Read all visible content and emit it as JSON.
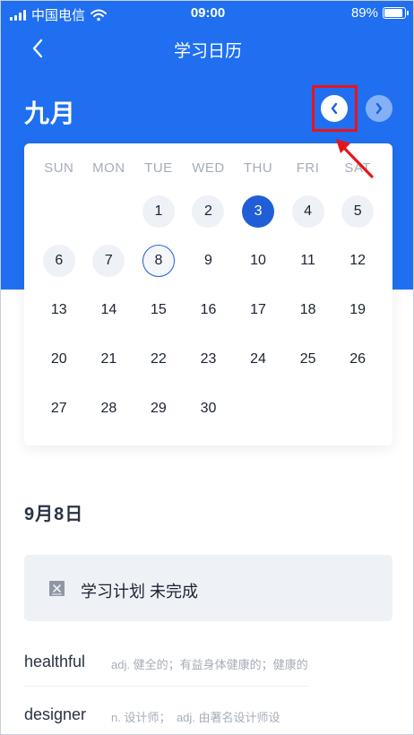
{
  "status_bar": {
    "carrier": "中国电信",
    "time": "09:00",
    "battery": "89%",
    "battery_level": 0.89
  },
  "nav": {
    "title": "学习日历",
    "back_icon": "chevron-left-icon"
  },
  "calendar": {
    "month": "九月",
    "prev_icon": "chevron-left-icon",
    "next_icon": "chevron-right-icon",
    "weekdays": [
      "SUN",
      "MON",
      "TUE",
      "WED",
      "THU",
      "FRI",
      "SAT"
    ],
    "weeks": [
      [
        {
          "d": ""
        },
        {
          "d": ""
        },
        {
          "d": "1",
          "state": "studied"
        },
        {
          "d": "2",
          "state": "studied"
        },
        {
          "d": "3",
          "state": "today"
        },
        {
          "d": "4",
          "state": "studied"
        },
        {
          "d": "5",
          "state": "studied"
        }
      ],
      [
        {
          "d": "6",
          "state": "studied"
        },
        {
          "d": "7",
          "state": "studied"
        },
        {
          "d": "8",
          "state": "selected"
        },
        {
          "d": "9"
        },
        {
          "d": "10"
        },
        {
          "d": "11"
        },
        {
          "d": "12"
        }
      ],
      [
        {
          "d": "13"
        },
        {
          "d": "14"
        },
        {
          "d": "15"
        },
        {
          "d": "16"
        },
        {
          "d": "17"
        },
        {
          "d": "18"
        },
        {
          "d": "19"
        }
      ],
      [
        {
          "d": "20"
        },
        {
          "d": "21"
        },
        {
          "d": "22"
        },
        {
          "d": "23"
        },
        {
          "d": "24"
        },
        {
          "d": "25"
        },
        {
          "d": "26"
        }
      ],
      [
        {
          "d": "27"
        },
        {
          "d": "28"
        },
        {
          "d": "29"
        },
        {
          "d": "30"
        },
        {
          "d": ""
        },
        {
          "d": ""
        },
        {
          "d": ""
        }
      ]
    ]
  },
  "selected_date": "9月8日",
  "plan": {
    "status_text": "学习计划 未完成",
    "icon": "incomplete-box-icon"
  },
  "words": [
    {
      "word": "healthful",
      "meaning": "adj. 健全的；有益身体健康的；健康的"
    },
    {
      "word": "designer",
      "meaning": "n. 设计师；　adj. 由著名设计师设"
    }
  ],
  "colors": {
    "primary": "#1f6ff0",
    "selected": "#1f5ed6",
    "annotation": "#e8141b"
  }
}
